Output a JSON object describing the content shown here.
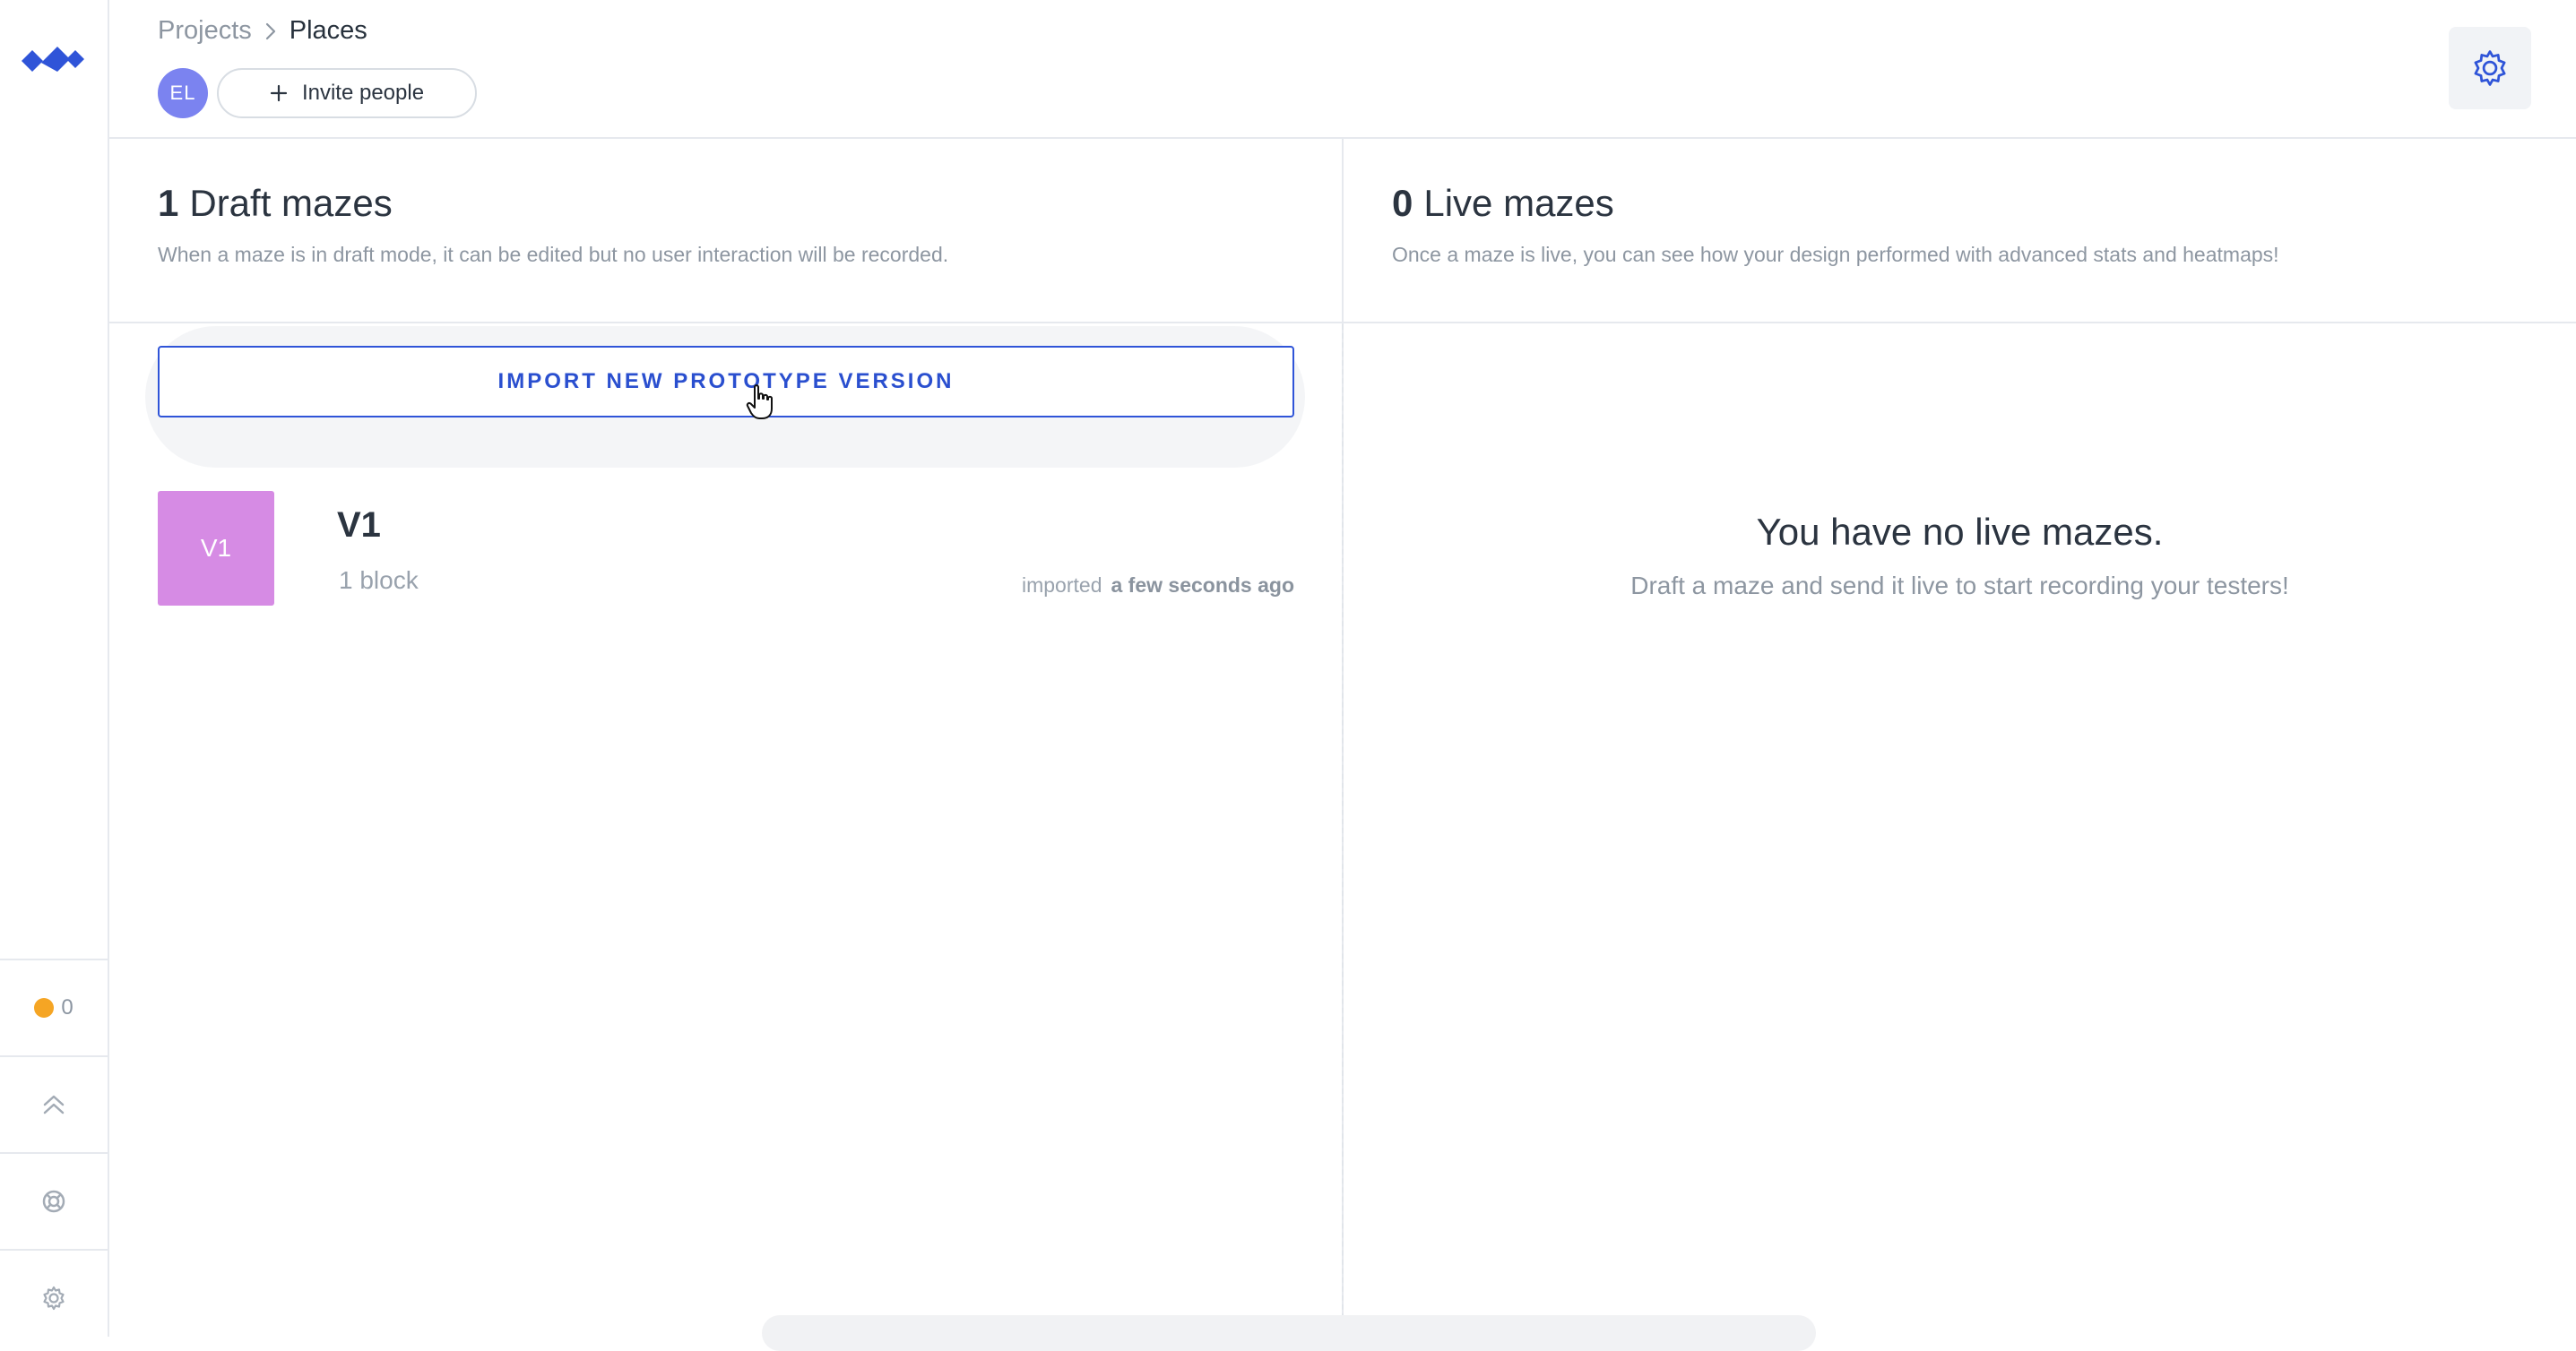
{
  "breadcrumb": {
    "parent": "Projects",
    "current": "Places"
  },
  "collaborators": {
    "avatar_initials": "EL",
    "invite_label": "Invite people"
  },
  "sidebar": {
    "credits_count": "0",
    "icons": [
      "logo-icon",
      "chevrons-up-icon",
      "help-lifebuoy-icon",
      "gear-icon"
    ]
  },
  "draft": {
    "count": "1",
    "title": "Draft mazes",
    "description": "When a maze is in draft mode, it can be edited but no user interaction will be recorded.",
    "import_button": "IMPORT NEW PROTOTYPE VERSION",
    "items": [
      {
        "thumb_label": "V1",
        "name": "V1",
        "blocks": "1 block",
        "imported_label": "imported",
        "imported_time": "a few seconds ago"
      }
    ]
  },
  "live": {
    "count": "0",
    "title": "Live mazes",
    "description": "Once a maze is live, you can see how your design performed with advanced stats and heatmaps!",
    "empty_title": "You have no live mazes.",
    "empty_description": "Draft a maze and send it live to start recording your testers!"
  },
  "colors": {
    "accent": "#2f54d8",
    "avatar": "#7b83f0",
    "thumb": "#d68be4",
    "credit_dot": "#f5a524"
  }
}
